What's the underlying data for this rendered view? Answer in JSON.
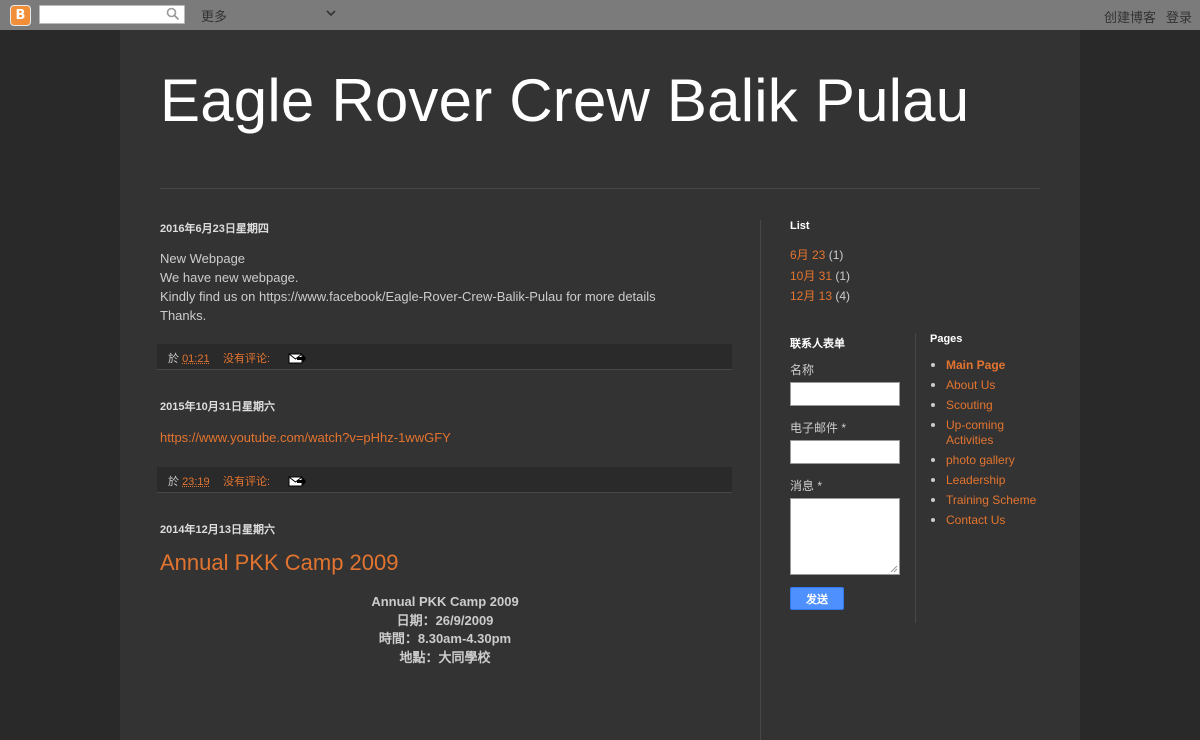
{
  "navbar": {
    "search_placeholder": "",
    "more_label": "更多",
    "create_blog": "创建博客",
    "sign_in": "登录"
  },
  "blog": {
    "title": "Eagle Rover Crew Balik Pulau"
  },
  "posts": [
    {
      "date": "2016年6月23日星期四",
      "body_lines": [
        "New Webpage",
        "We have new webpage.",
        "Kindly find us on https://www.facebook/Eagle-Rover-Crew-Balik-Pulau for more details",
        "Thanks."
      ],
      "footer": {
        "by": "於",
        "time": "01:21",
        "comments": "没有评论:"
      }
    },
    {
      "date": "2015年10月31日星期六",
      "link": "https://www.youtube.com/watch?v=pHhz-1wwGFY",
      "footer": {
        "by": "於",
        "time": "23:19",
        "comments": "没有评论:"
      }
    },
    {
      "date": "2014年12月13日星期六",
      "title": "Annual PKK Camp 2009",
      "body_lines": [
        "Annual PKK Camp 2009",
        "日期：26/9/2009",
        "時間：8.30am-4.30pm",
        "地點：大同學校"
      ]
    }
  ],
  "sidebar": {
    "list": {
      "title": "List",
      "items": [
        {
          "label": "6月 23",
          "count": "(1)"
        },
        {
          "label": "10月 31",
          "count": "(1)"
        },
        {
          "label": "12月 13",
          "count": "(4)"
        }
      ]
    },
    "contact": {
      "title": "联系人表单",
      "name_label": "名称",
      "email_label": "电子邮件 *",
      "message_label": "消息 *",
      "send_label": "发送"
    },
    "pages": {
      "title": "Pages",
      "items": [
        "Main Page",
        "About Us",
        "Scouting",
        "Up-coming Activities",
        "photo gallery",
        "Leadership",
        "Training Scheme",
        "Contact Us"
      ]
    }
  },
  "colors": {
    "accent": "#e3742f",
    "background": "#292929",
    "panel": "#333333"
  }
}
